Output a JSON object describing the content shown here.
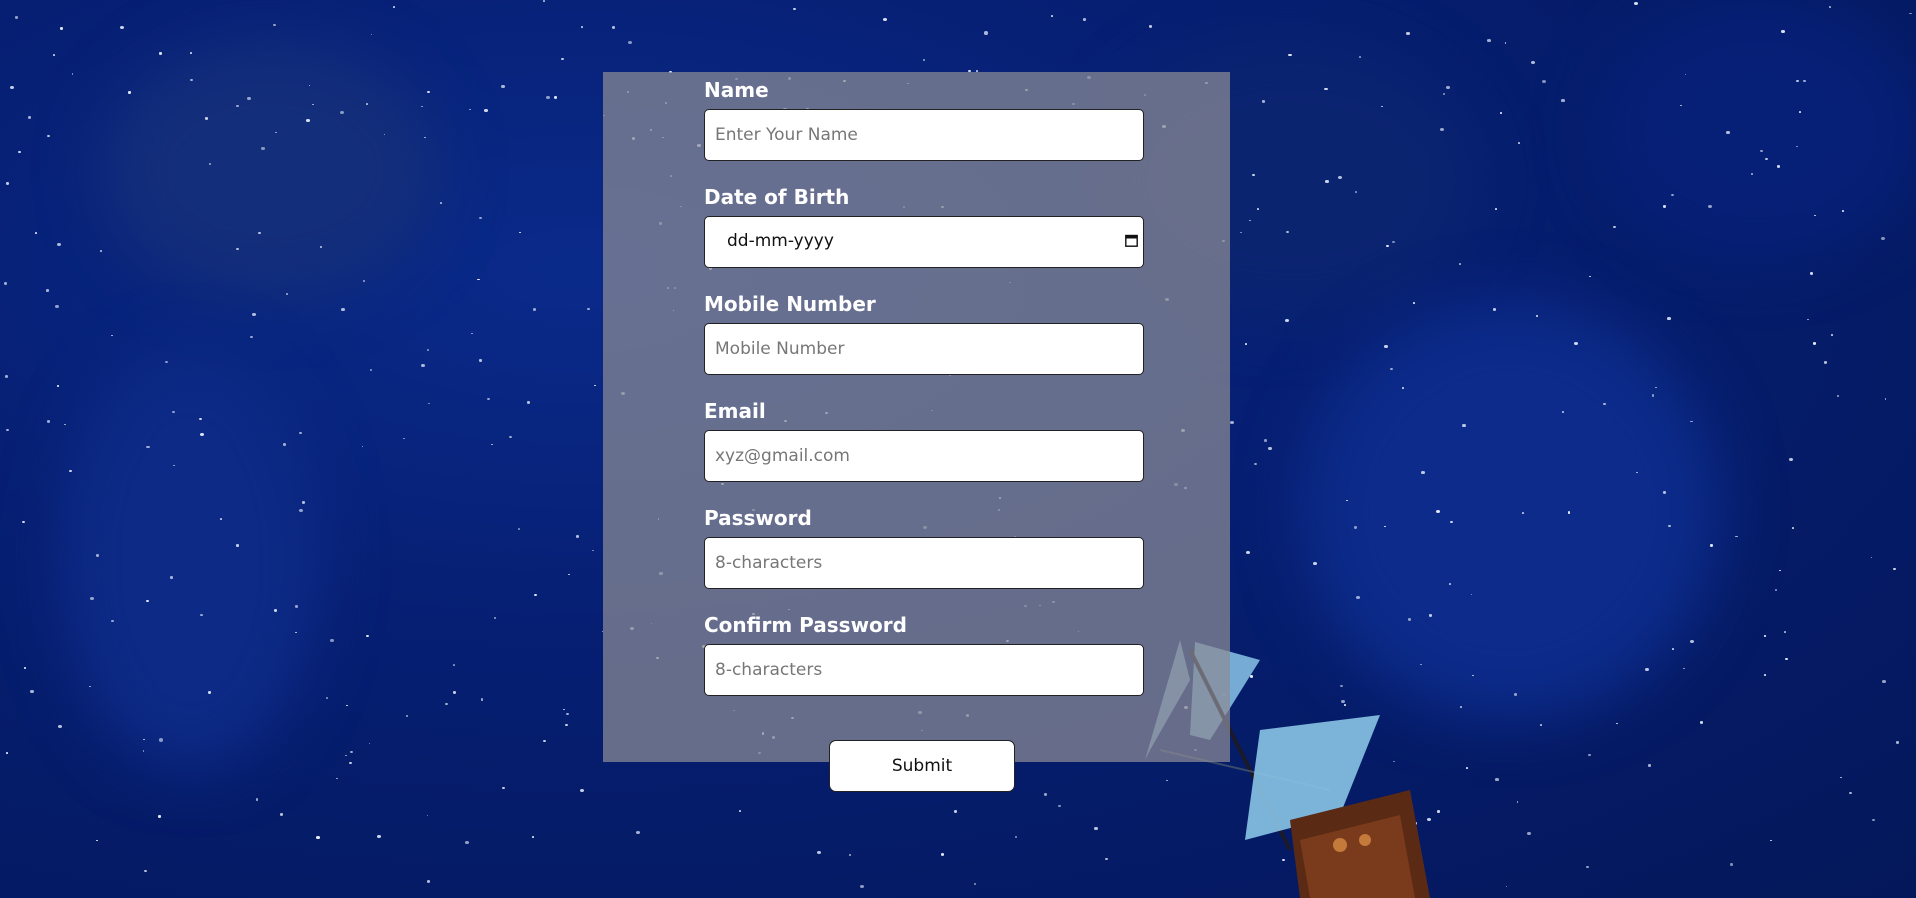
{
  "form": {
    "fields": [
      {
        "label": "Name",
        "placeholder": "Enter Your Name",
        "type": "text"
      },
      {
        "label": "Date of Birth",
        "value": "dd-mm-yyyy",
        "type": "date"
      },
      {
        "label": "Mobile Number",
        "placeholder": "Mobile Number",
        "type": "tel"
      },
      {
        "label": "Email",
        "placeholder": "xyz@gmail.com",
        "type": "email"
      },
      {
        "label": "Password",
        "placeholder": "8-characters",
        "type": "password"
      },
      {
        "label": "Confirm Password",
        "placeholder": "8-characters",
        "type": "password"
      }
    ],
    "submit_label": "Submit"
  },
  "colors": {
    "background": "#061f73",
    "panel": "#8c8c96",
    "label_text": "#ffffff"
  },
  "icons": {
    "calendar": "calendar-icon"
  }
}
